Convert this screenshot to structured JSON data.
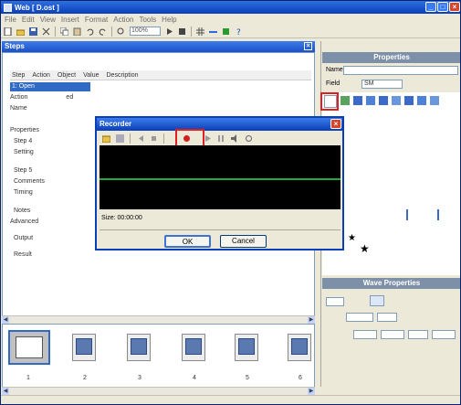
{
  "window": {
    "title": "Web [ D.ost ]",
    "caption_buttons": {
      "minimize": "_",
      "maximize": "□",
      "close": "×"
    }
  },
  "menubar": {
    "items": [
      "File",
      "Edit",
      "View",
      "Insert",
      "Format",
      "Action",
      "Tools",
      "Help"
    ]
  },
  "toolbar": {
    "zoom_combo": "100%"
  },
  "left_panel": {
    "title": "Steps",
    "close": "×",
    "columns": [
      "Step",
      "Action",
      "Object",
      "Value",
      "Description"
    ],
    "selected_row": "1: Open",
    "items": [
      {
        "label": "Action",
        "value": "ed"
      },
      {
        "label": "Name",
        "value": ""
      },
      {
        "label": "Properties",
        "value": ""
      },
      {
        "label": "Step 4",
        "value": ""
      },
      {
        "label": "Setting",
        "value": ""
      },
      {
        "label": "Step 5",
        "value": ""
      },
      {
        "label": "Comments",
        "value": ""
      },
      {
        "label": "Timing",
        "value": ""
      },
      {
        "label": "Notes",
        "value": ""
      },
      {
        "label": "Advanced",
        "value": ""
      },
      {
        "label": "Output",
        "value": ""
      },
      {
        "label": "Result",
        "value": ""
      }
    ]
  },
  "right_panel": {
    "header": "Properties",
    "header2": "Wave Properties",
    "name_label": "Name",
    "field_label": "Field",
    "field_value": "SM"
  },
  "dialog": {
    "title": "Recorder",
    "status": "Size: 00:00:00",
    "ok_label": "OK",
    "cancel_label": "Cancel",
    "close": "×"
  },
  "thumbnails": {
    "labels": [
      "1",
      "2",
      "3",
      "4",
      "5",
      "6"
    ]
  },
  "colors": {
    "titlebar": "#0a3fb8",
    "selection": "#316ac5",
    "waveform_bg": "#000000",
    "waveform_line": "#1faa3a",
    "highlight": "#e02020"
  }
}
